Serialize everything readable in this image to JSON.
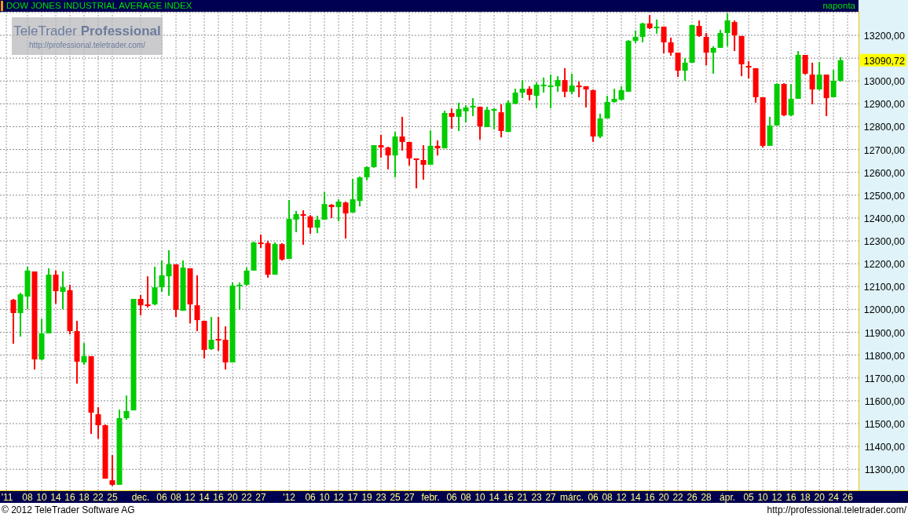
{
  "title_bar": {
    "title": "DOW JONES INDUSTRIAL AVERAGE INDEX",
    "interval": "naponta"
  },
  "logo": {
    "name": "TeleTrader **Professional**",
    "url": "http://professional.teletrader.com/"
  },
  "chart": {
    "last_price_label": "13090,72",
    "chart_data": {
      "type": "candlestick",
      "grid": true,
      "ylim": [
        11208,
        13303
      ],
      "categories": [
        "'11",
        null,
        null,
        "08",
        null,
        "10",
        null,
        "14",
        null,
        "16",
        null,
        "18",
        null,
        "22",
        null,
        "25",
        null,
        null,
        null,
        "dec.",
        null,
        null,
        "06",
        null,
        "08",
        null,
        "12",
        null,
        "14",
        null,
        "16",
        null,
        "20",
        null,
        "22",
        null,
        "27",
        null,
        null,
        null,
        "'12",
        null,
        null,
        "06",
        null,
        "10",
        null,
        "12",
        null,
        "17",
        null,
        "19",
        null,
        "23",
        null,
        "25",
        null,
        "27",
        null,
        null,
        "febr.",
        null,
        null,
        "06",
        null,
        "08",
        null,
        "10",
        null,
        "14",
        null,
        "16",
        null,
        "21",
        null,
        "23",
        null,
        "27",
        null,
        null,
        "márc.",
        null,
        null,
        "06",
        null,
        "08",
        null,
        "12",
        null,
        "14",
        null,
        "16",
        null,
        "20",
        null,
        "22",
        null,
        "26",
        null,
        "28",
        null,
        null,
        "ápr.",
        null,
        null,
        "05",
        null,
        "10",
        null,
        "12",
        null,
        "16",
        null,
        "18",
        null,
        "20",
        null,
        "24",
        null,
        "26"
      ],
      "yticks": [
        {
          "value": 11300,
          "label": "11300,00"
        },
        {
          "value": 11400,
          "label": "11400,00"
        },
        {
          "value": 11500,
          "label": "11500,00"
        },
        {
          "value": 11600,
          "label": "11600,00"
        },
        {
          "value": 11700,
          "label": "11700,00"
        },
        {
          "value": 11800,
          "label": "11800,00"
        },
        {
          "value": 11900,
          "label": "11900,00"
        },
        {
          "value": 12000,
          "label": "12000,00"
        },
        {
          "value": 12100,
          "label": "12100,00"
        },
        {
          "value": 12200,
          "label": "12200,00"
        },
        {
          "value": 12300,
          "label": "12300,00"
        },
        {
          "value": 12400,
          "label": "12400,00"
        },
        {
          "value": 12500,
          "label": "12500,00"
        },
        {
          "value": 12600,
          "label": "12600,00"
        },
        {
          "value": 12700,
          "label": "12700,00"
        },
        {
          "value": 12800,
          "label": "12800,00"
        },
        {
          "value": 12900,
          "label": "12900,00"
        },
        {
          "value": 13000,
          "label": "13000,00"
        },
        {
          "value": 13200,
          "label": "13200,00"
        }
      ],
      "ohlc": [
        null,
        [
          12042,
          12046,
          11850,
          11984
        ],
        [
          11984,
          12073,
          11881,
          12066
        ],
        [
          12056,
          12187,
          12001,
          12170
        ],
        [
          12166,
          12166,
          11737,
          11781
        ],
        [
          11781,
          11960,
          11778,
          11895
        ],
        [
          11895,
          12180,
          11895,
          12152
        ],
        [
          12152,
          12170,
          12025,
          12080
        ],
        [
          12077,
          12166,
          12001,
          12097
        ],
        [
          12084,
          12108,
          11891,
          11905
        ],
        [
          11905,
          11950,
          11675,
          11771
        ],
        [
          11768,
          11853,
          11757,
          11795
        ],
        [
          11795,
          11795,
          11455,
          11548
        ],
        [
          11541,
          11572,
          11434,
          11493
        ],
        [
          11493,
          11496,
          11259,
          11259
        ],
        [
          11252,
          11362,
          11228,
          11232
        ],
        [
          11232,
          11561,
          11232,
          11524
        ],
        [
          11524,
          11623,
          11517,
          11555
        ],
        [
          11558,
          12046,
          11558,
          12046
        ],
        [
          12046,
          12063,
          11974,
          12018
        ],
        [
          12022,
          12145,
          12008,
          12015
        ],
        [
          12022,
          12187,
          12018,
          12097
        ],
        [
          12097,
          12214,
          12077,
          12149
        ],
        [
          12145,
          12259,
          12060,
          12197
        ],
        [
          12197,
          12197,
          11967,
          11998
        ],
        [
          11994,
          12214,
          11994,
          12183
        ],
        [
          12180,
          12180,
          11939,
          12022
        ],
        [
          12018,
          12149,
          11905,
          11953
        ],
        [
          11950,
          11950,
          11785,
          11823
        ],
        [
          11826,
          11967,
          11823,
          11867
        ],
        [
          11871,
          11967,
          11819,
          11864
        ],
        [
          11867,
          11926,
          11737,
          11768
        ],
        [
          11768,
          12118,
          11768,
          12104
        ],
        [
          12101,
          12118,
          11998,
          12108
        ],
        [
          12108,
          12183,
          12104,
          12170
        ],
        [
          12170,
          12297,
          12170,
          12293
        ],
        [
          12293,
          12328,
          12269,
          12286
        ],
        [
          12290,
          12300,
          12139,
          12152
        ],
        [
          12152,
          12293,
          12152,
          12286
        ],
        [
          12286,
          12290,
          12214,
          12218
        ],
        [
          12221,
          12479,
          12221,
          12396
        ],
        [
          12393,
          12431,
          12338,
          12417
        ],
        [
          12417,
          12434,
          12283,
          12410
        ],
        [
          12407,
          12413,
          12331,
          12358
        ],
        [
          12358,
          12410,
          12334,
          12393
        ],
        [
          12393,
          12513,
          12393,
          12461
        ],
        [
          12458,
          12461,
          12400,
          12448
        ],
        [
          12448,
          12482,
          12386,
          12472
        ],
        [
          12468,
          12472,
          12310,
          12420
        ],
        [
          12424,
          12571,
          12424,
          12482
        ],
        [
          12475,
          12582,
          12451,
          12578
        ],
        [
          12578,
          12626,
          12565,
          12623
        ],
        [
          12623,
          12719,
          12620,
          12719
        ],
        [
          12719,
          12764,
          12664,
          12709
        ],
        [
          12709,
          12712,
          12613,
          12674
        ],
        [
          12674,
          12777,
          12578,
          12757
        ],
        [
          12757,
          12843,
          12695,
          12733
        ],
        [
          12733,
          12733,
          12630,
          12661
        ],
        [
          12661,
          12661,
          12530,
          12654
        ],
        [
          12654,
          12719,
          12568,
          12633
        ],
        [
          12633,
          12784,
          12633,
          12716
        ],
        [
          12716,
          12740,
          12674,
          12705
        ],
        [
          12705,
          12870,
          12705,
          12860
        ],
        [
          12860,
          12880,
          12791,
          12843
        ],
        [
          12843,
          12905,
          12781,
          12877
        ],
        [
          12867,
          12894,
          12819,
          12884
        ],
        [
          12884,
          12925,
          12846,
          12891
        ],
        [
          12887,
          12887,
          12743,
          12802
        ],
        [
          12798,
          12887,
          12798,
          12874
        ],
        [
          12870,
          12881,
          12788,
          12877
        ],
        [
          12863,
          12898,
          12753,
          12781
        ],
        [
          12777,
          12915,
          12777,
          12905
        ],
        [
          12901,
          12966,
          12898,
          12949
        ],
        [
          12949,
          13004,
          12925,
          12966
        ],
        [
          12966,
          12977,
          12915,
          12939
        ],
        [
          12935,
          12994,
          12881,
          12984
        ],
        [
          12977,
          13015,
          12949,
          12984
        ],
        [
          12973,
          13028,
          12881,
          12980
        ],
        [
          12977,
          13021,
          12953,
          13004
        ],
        [
          13004,
          13056,
          12929,
          12953
        ],
        [
          12953,
          13032,
          12942,
          12980
        ],
        [
          12980,
          12997,
          12929,
          12973
        ],
        [
          12977,
          12977,
          12884,
          12963
        ],
        [
          12960,
          12963,
          12733,
          12757
        ],
        [
          12757,
          12857,
          12750,
          12836
        ],
        [
          12836,
          12935,
          12836,
          12908
        ],
        [
          12908,
          12966,
          12905,
          12922
        ],
        [
          12918,
          12977,
          12915,
          12960
        ],
        [
          12953,
          13179,
          12953,
          13176
        ],
        [
          13176,
          13221,
          13166,
          13193
        ],
        [
          13193,
          13255,
          13169,
          13252
        ],
        [
          13252,
          13289,
          13227,
          13231
        ],
        [
          13231,
          13269,
          13207,
          13238
        ],
        [
          13238,
          13238,
          13121,
          13169
        ],
        [
          13169,
          13190,
          13111,
          13124
        ],
        [
          13124,
          13124,
          13018,
          13045
        ],
        [
          13045,
          13100,
          13001,
          13080
        ],
        [
          13080,
          13245,
          13080,
          13245
        ],
        [
          13241,
          13265,
          13193,
          13197
        ],
        [
          13193,
          13210,
          13069,
          13124
        ],
        [
          13124,
          13152,
          13032,
          13145
        ],
        [
          13145,
          13224,
          13145,
          13210
        ],
        [
          13210,
          13296,
          13152,
          13265
        ],
        [
          13258,
          13265,
          13131,
          13200
        ],
        [
          13197,
          13197,
          13021,
          13073
        ],
        [
          13066,
          13087,
          13011,
          13059
        ],
        [
          13056,
          13056,
          12905,
          12929
        ],
        [
          12929,
          12929,
          12709,
          12716
        ],
        [
          12716,
          12843,
          12716,
          12805
        ],
        [
          12805,
          12990,
          12805,
          12987
        ],
        [
          12987,
          12990,
          12846,
          12850
        ],
        [
          12850,
          12987,
          12846,
          12922
        ],
        [
          12922,
          13131,
          12922,
          13114
        ],
        [
          13114,
          13114,
          13028,
          13032
        ],
        [
          13028,
          13080,
          12898,
          12963
        ],
        [
          12963,
          13083,
          12960,
          13028
        ],
        [
          13028,
          13028,
          12846,
          12925
        ],
        [
          12929,
          13049,
          12929,
          13001
        ],
        [
          13001,
          13104,
          12997,
          13091
        ],
        null
      ]
    }
  },
  "footer": {
    "copyright": "© 2012 TeleTrader Software AG",
    "url": "http://professional.teletrader.com/"
  }
}
